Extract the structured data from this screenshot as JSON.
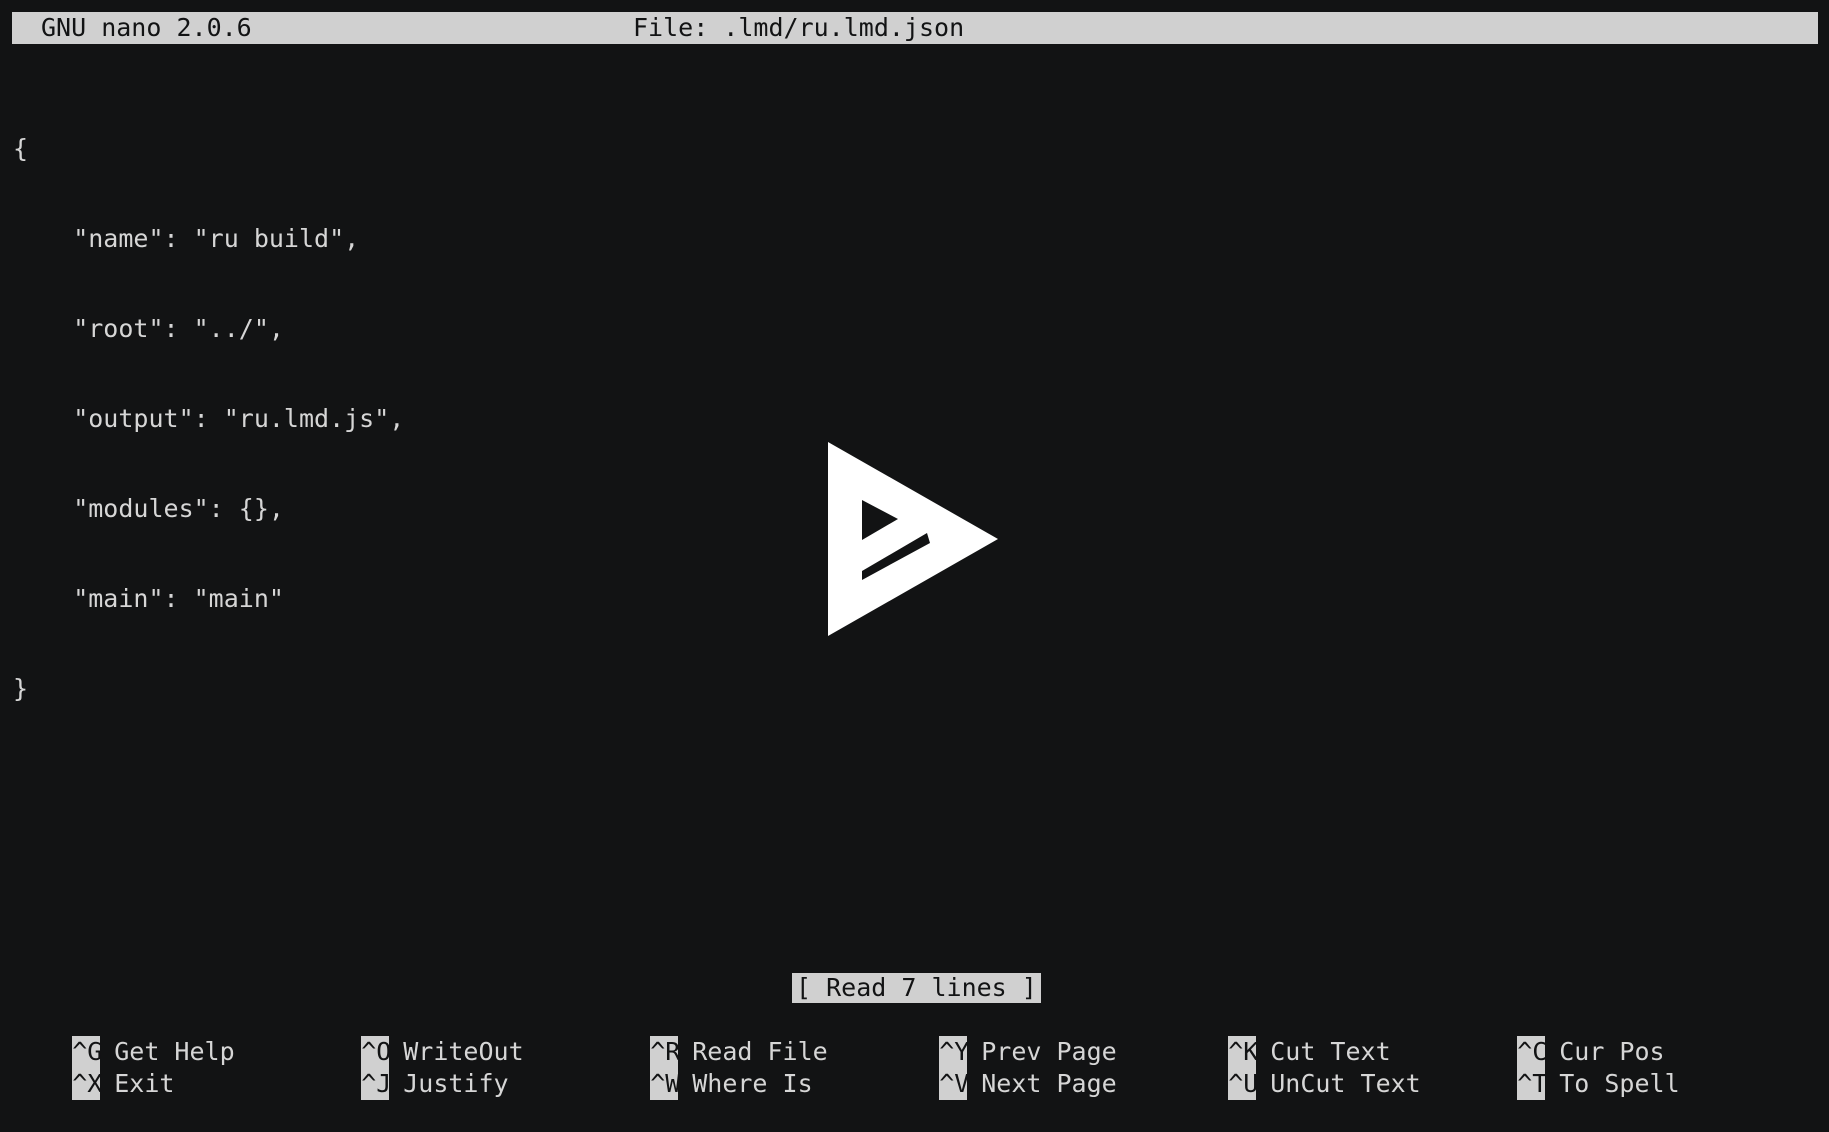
{
  "window": {
    "app_name": "GNU nano 2.0.6",
    "file_label": "File: .lmd/ru.lmd.json"
  },
  "editor": {
    "lines": [
      "{",
      "    \"name\": \"ru build\",",
      "    \"root\": \"../\",",
      "    \"output\": \"ru.lmd.js\",",
      "    \"modules\": {},",
      "    \"main\": \"main\"",
      "}"
    ]
  },
  "overlay": {
    "icon": "play-icon",
    "color": "#ffffff"
  },
  "status": {
    "message": "[ Read 7 lines ]"
  },
  "shortcuts": {
    "row1": [
      {
        "key": "^G",
        "label": "Get Help"
      },
      {
        "key": "^O",
        "label": "WriteOut"
      },
      {
        "key": "^R",
        "label": "Read File"
      },
      {
        "key": "^Y",
        "label": "Prev Page"
      },
      {
        "key": "^K",
        "label": "Cut Text"
      },
      {
        "key": "^C",
        "label": "Cur Pos"
      }
    ],
    "row2": [
      {
        "key": "^X",
        "label": "Exit"
      },
      {
        "key": "^J",
        "label": "Justify"
      },
      {
        "key": "^W",
        "label": "Where Is"
      },
      {
        "key": "^V",
        "label": "Next Page"
      },
      {
        "key": "^U",
        "label": "UnCut Text"
      },
      {
        "key": "^T",
        "label": "To Spell"
      }
    ]
  },
  "colors": {
    "background": "#121314",
    "foreground": "#d6d6d6",
    "inverse_bg": "#d0d0d0"
  }
}
